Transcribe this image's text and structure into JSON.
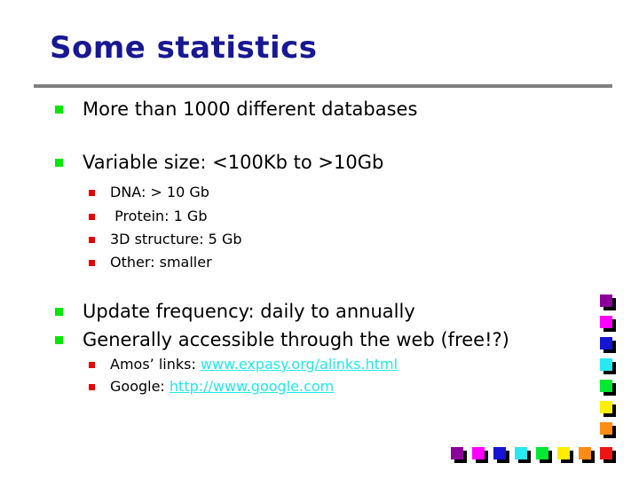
{
  "slide": {
    "title": "Some statistics",
    "title_color": "#181893",
    "background_color": "#ffffff",
    "rule_color": "#808080"
  },
  "bullets": {
    "level1_bullet_color": "#00e800",
    "level2_bullet_color": "#e80000",
    "link_color": "#22e8e8",
    "items": [
      {
        "level": 1,
        "text": "More than 1000 different databases"
      },
      {
        "level": 1,
        "text": "Variable size: <100Kb to >10Gb"
      },
      {
        "level": 2,
        "text": "DNA: > 10 Gb"
      },
      {
        "level": 2,
        "text": " Protein: 1 Gb"
      },
      {
        "level": 2,
        "text": "3D structure: 5 Gb"
      },
      {
        "level": 2,
        "text": "Other: smaller"
      },
      {
        "level": 1,
        "text": "Update frequency: daily to annually"
      },
      {
        "level": 1,
        "text": "Generally accessible through the web (free!?)"
      }
    ],
    "link_items": [
      {
        "label": "Amos’ links: ",
        "link": "www.expasy.org/alinks.html"
      },
      {
        "label": "Google: ",
        "link": "http://www.google.com"
      }
    ]
  },
  "decoration": {
    "square_colors": [
      "#8b009b",
      "#ff00ff",
      "#1414d2",
      "#28e8f0",
      "#00e832",
      "#ffee00",
      "#ff8c14",
      "#ee1414"
    ],
    "column_label": "right-color-column",
    "row_label": "bottom-color-row"
  }
}
